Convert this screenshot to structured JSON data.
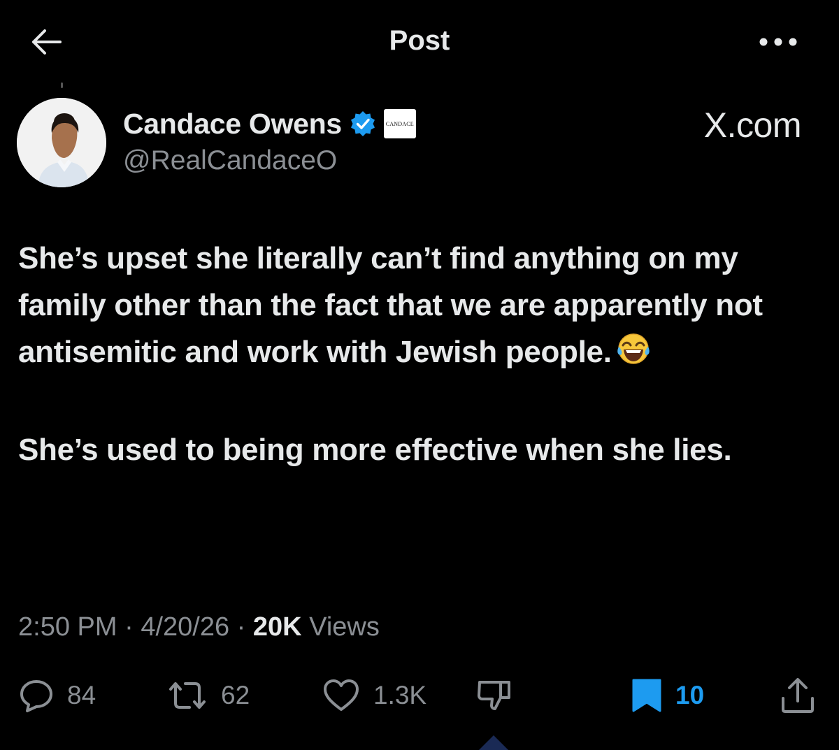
{
  "header": {
    "title": "Post",
    "back_icon": "arrow-left-icon",
    "more_icon": "more-horizontal-icon"
  },
  "author": {
    "name": "Candace Owens",
    "handle": "@RealCandaceO",
    "verified_badge_color": "#1d9bf0",
    "affiliation_badge_text": "CANDACE",
    "source": "X.com"
  },
  "post": {
    "paragraphs": [
      "She’s upset she literally can’t find anything on my family other than the fact that we are apparently not antisemitic and work with Jewish people.",
      "She’s used to being more effective when she lies."
    ],
    "emoji": "face-with-tears-of-joy"
  },
  "meta": {
    "time": "2:50 PM",
    "date": "4/20/26",
    "views_count": "20K",
    "views_label": "Views",
    "separator": "·"
  },
  "actions": {
    "replies": "84",
    "reposts": "62",
    "likes": "1.3K",
    "bookmarks": "10",
    "bookmark_color": "#1d9bf0"
  }
}
